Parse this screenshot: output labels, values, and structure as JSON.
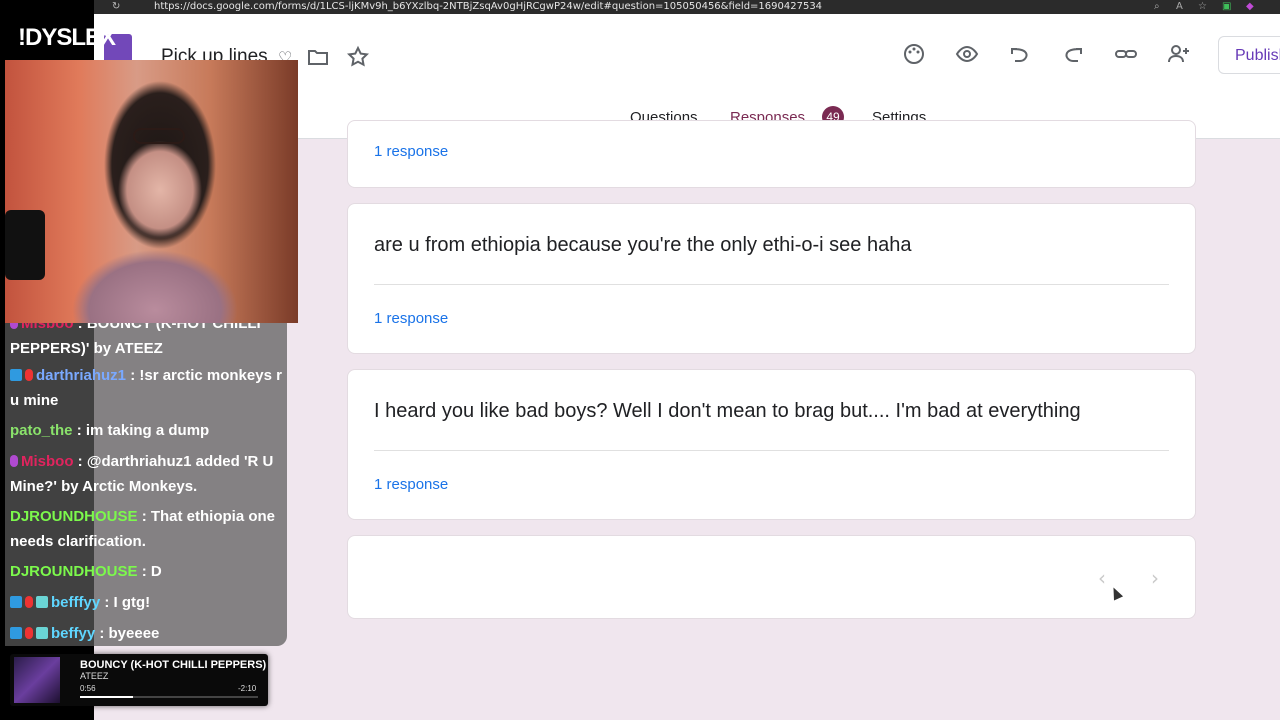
{
  "browser": {
    "url": "https://docs.google.com/forms/d/1LCS-ljKMv9h_b6YXzlbq-2NTBjZsqAv0gHjRCgwP24w/edit#question=105050456&field=1690427534"
  },
  "stream": {
    "channel_logo": "!DYSLEX",
    "now_playing": {
      "title": "BOUNCY (K-HOT CHILLI PEPPERS)",
      "artist": "ATEEZ",
      "elapsed": "0:56",
      "remaining": "-2:10",
      "progress": 0.3
    },
    "chat": [
      {
        "user": "Misboo",
        "text": ": BOUNCY (K-HOT CHILLI PEPPERS)' by ATEEZ"
      },
      {
        "user": "darthriahuz1",
        "text": ": !sr arctic monkeys r u mine"
      },
      {
        "user": "pato_the",
        "text": ": im taking a dump"
      },
      {
        "user": "Misboo",
        "text": ": @darthriahuz1 added 'R U Mine?' by Arctic Monkeys."
      },
      {
        "user": "DJROUNDHOUSE",
        "text": ": That ethiopia one needs clarification."
      },
      {
        "user": "DJROUNDHOUSE",
        "text": ": D"
      },
      {
        "user": "befffyy",
        "text": ": I gtg!"
      },
      {
        "user": "beffyy",
        "text": ": byeeee"
      }
    ]
  },
  "form": {
    "title": "Pick up lines",
    "publish_label": "Publish",
    "tabs": {
      "questions": "Questions",
      "responses": "Responses",
      "responses_count": "49",
      "settings": "Settings"
    },
    "toolbar_icons": [
      "palette-icon",
      "preview-eye-icon",
      "undo-icon",
      "redo-icon",
      "link-icon",
      "add-collaborator-icon"
    ],
    "responses": [
      {
        "question": "",
        "count_label": "1 response"
      },
      {
        "question": "are u from ethiopia because you're the only ethi-o-i see haha",
        "count_label": "1 response"
      },
      {
        "question": "I heard you like bad boys? Well I don't mean to brag but.... I'm bad at everything",
        "count_label": "1 response"
      }
    ],
    "pager": {
      "prev": "‹",
      "next": "›"
    }
  }
}
